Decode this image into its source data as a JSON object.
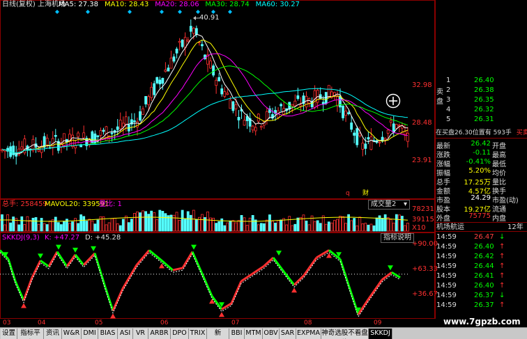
{
  "header": {
    "title": "日线(复权) 上海机场",
    "ma_items": [
      {
        "label": "MA5: 27.38",
        "color": "#ffffff"
      },
      {
        "label": "MA10: 28.43",
        "color": "#ffff00"
      },
      {
        "label": "MA20: 28.06",
        "color": "#ff00ff"
      },
      {
        "label": "MA30: 28.74",
        "color": "#00ff00"
      },
      {
        "label": "MA60: 30.27",
        "color": "#00ffff"
      }
    ]
  },
  "price_chart": {
    "peak_label": "40.91",
    "low_label": "23.91",
    "axis_labels": [
      "32.98",
      "28.48",
      "23.91"
    ],
    "markers": [
      "q",
      "财"
    ]
  },
  "volume_panel": {
    "title": "总手: 258459",
    "ma_label": "MAVOL20: 339591",
    "ratio_label": "量比: 1",
    "dropdown": "成交量2",
    "axis_labels": [
      "78231",
      "39115",
      "X10"
    ]
  },
  "indicator_panel": {
    "title": "SKKDJ(9,3)",
    "k_label": "K: +47.27",
    "d_label": "D: +45.28",
    "help_button": "指标说明",
    "axis_labels": [
      "+90.00",
      "+63.33",
      "+36.67"
    ]
  },
  "x_axis": {
    "labels": [
      "03",
      "04",
      "05",
      "06",
      "07",
      "08",
      "09"
    ]
  },
  "order_book": {
    "sell_label": "卖盘",
    "buy_label": "买盘",
    "sell": [
      {
        "n": "1",
        "price": "26.40"
      },
      {
        "n": "2",
        "price": "26.38"
      },
      {
        "n": "3",
        "price": "26.35"
      },
      {
        "n": "4",
        "price": "26.32"
      },
      {
        "n": "5",
        "price": "26.31"
      }
    ],
    "status_line": "在买盘26.30位置有 593手",
    "status_line_tail": "买卖"
  },
  "quote": [
    {
      "l1": "最新",
      "v1": "26.42",
      "l2": "开盘",
      "c1": "#00ff00"
    },
    {
      "l1": "涨跌",
      "v1": "-0.11",
      "l2": "最高",
      "c1": "#00ff00"
    },
    {
      "l1": "涨幅",
      "v1": "-0.41%",
      "l2": "最低",
      "c1": "#00ff00"
    },
    {
      "l1": "振幅",
      "v1": "5.20%",
      "l2": "均价",
      "c1": "#ffff00"
    },
    {
      "l1": "总手",
      "v1": "17.25万",
      "l2": "量比",
      "c1": "#ffff00"
    },
    {
      "l1": "金额",
      "v1": "4.57亿",
      "l2": "换手",
      "c1": "#ffff00"
    },
    {
      "l1": "市盈",
      "v1": "24.29",
      "l2": "市盈(动)",
      "c1": "#ffffff"
    },
    {
      "l1": "股本",
      "v1": "19.27亿",
      "l2": "流通",
      "c1": "#ffff00"
    },
    {
      "l1": "外盘",
      "v1": "75775",
      "l2": "内盘",
      "c1": "#ff3030"
    }
  ],
  "ticks_panel": {
    "title": "机场航运",
    "title2": "12年",
    "rows": [
      {
        "time": "14:59",
        "price": "26.47",
        "dir": "↓",
        "color": "#ff4040"
      },
      {
        "time": "14:59",
        "price": "26.40",
        "dir": "↑",
        "color": "#00ff00"
      },
      {
        "time": "14:59",
        "price": "26.42",
        "dir": "↑",
        "color": "#00ff00"
      },
      {
        "time": "14:59",
        "price": "26.44",
        "dir": "↑",
        "color": "#00ff00"
      },
      {
        "time": "14:59",
        "price": "26.41",
        "dir": "↑",
        "color": "#00ff00"
      },
      {
        "time": "14:59",
        "price": "26.40",
        "dir": "↑",
        "color": "#00ff00"
      },
      {
        "time": "14:59",
        "price": "26.37",
        "dir": "↓",
        "color": "#00ff00"
      },
      {
        "time": "14:59",
        "price": "26.37",
        "dir": "↑",
        "color": "#00ff00"
      }
    ]
  },
  "watermark": "www.7gpzb.com",
  "tabs": [
    "设置",
    "指标平台",
    "资讯",
    "W&R",
    "DMI",
    "BIAS",
    "ASI",
    "VR",
    "ARBR",
    "DPO",
    "TRIX",
    "新DMA",
    "BBI",
    "MTM",
    "OBV",
    "SAR",
    "EXPMA",
    "神奇选股不看盘线",
    "SKKDJ"
  ],
  "active_tab": "SKKDJ"
}
